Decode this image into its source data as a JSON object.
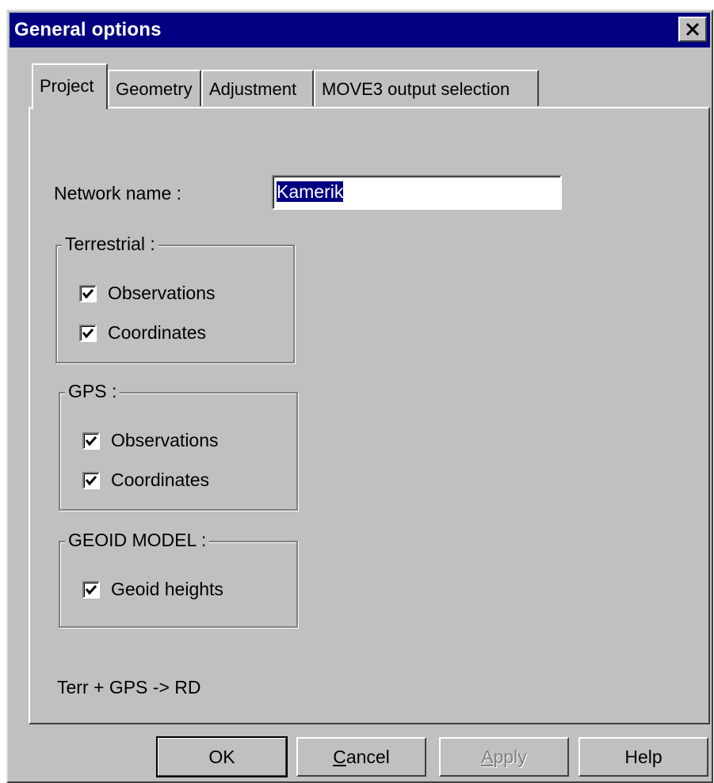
{
  "window": {
    "title": "General options",
    "close_icon": "close-icon"
  },
  "tabs": [
    {
      "label": "Project",
      "active": true
    },
    {
      "label": "Geometry",
      "active": false
    },
    {
      "label": "Adjustment",
      "active": false
    },
    {
      "label": "MOVE3 output selection",
      "active": false
    }
  ],
  "project": {
    "network_name_label": "Network name :",
    "network_name_value": "Kamerik",
    "terrestrial": {
      "title": "Terrestrial :",
      "observations_label": "Observations",
      "observations_checked": true,
      "coordinates_label": "Coordinates",
      "coordinates_checked": true
    },
    "gps": {
      "title": "GPS :",
      "observations_label": "Observations",
      "observations_checked": true,
      "coordinates_label": "Coordinates",
      "coordinates_checked": true
    },
    "geoid": {
      "title": "GEOID MODEL :",
      "heights_label": "Geoid heights",
      "heights_checked": true
    },
    "mode_text": "Terr + GPS -> RD"
  },
  "buttons": {
    "ok": "OK",
    "cancel_mnemonic": "C",
    "cancel_rest": "ancel",
    "apply_mnemonic": "A",
    "apply_rest": "pply",
    "help": "Help"
  }
}
